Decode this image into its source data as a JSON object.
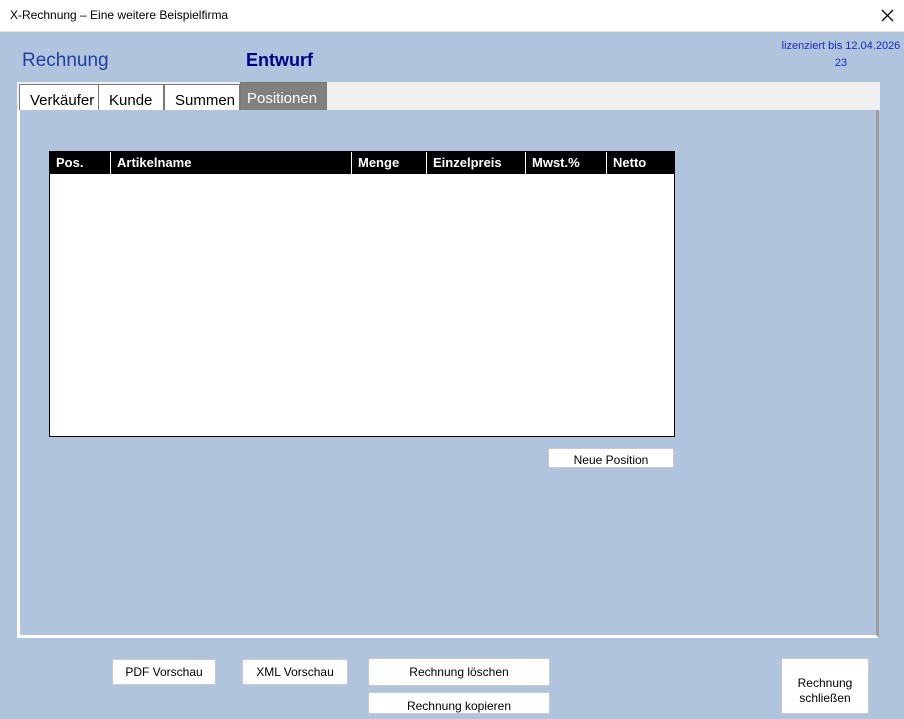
{
  "window": {
    "title": "X-Rechnung – Eine weitere Beispielfirma",
    "close_icon": "close-icon"
  },
  "header": {
    "doc_type": "Rechnung",
    "status": "Entwurf",
    "license_line1": "lizenziert bis 12.04.2026",
    "license_line2": "23"
  },
  "tabs": [
    {
      "label": "Verkäufer"
    },
    {
      "label": "Kunde"
    },
    {
      "label": "Summen"
    },
    {
      "label": "Positionen",
      "active": true
    }
  ],
  "positions_table": {
    "columns": [
      "Pos.",
      "Artikelname",
      "Menge",
      "Einzelpreis",
      "Mwst.%",
      "Netto"
    ],
    "rows": []
  },
  "buttons": {
    "new_position": "Neue Position",
    "pdf_preview": "PDF Vorschau",
    "xml_preview": "XML Vorschau",
    "delete_invoice": "Rechnung löschen",
    "copy_invoice": "Rechnung kopieren",
    "close_invoice_line1": "Rechnung",
    "close_invoice_line2": "schließen"
  },
  "colors": {
    "background": "#b0c4de",
    "header_text": "#1f3fa0",
    "status_text": "#00008b",
    "active_tab": "#808080",
    "table_header": "#000000"
  }
}
